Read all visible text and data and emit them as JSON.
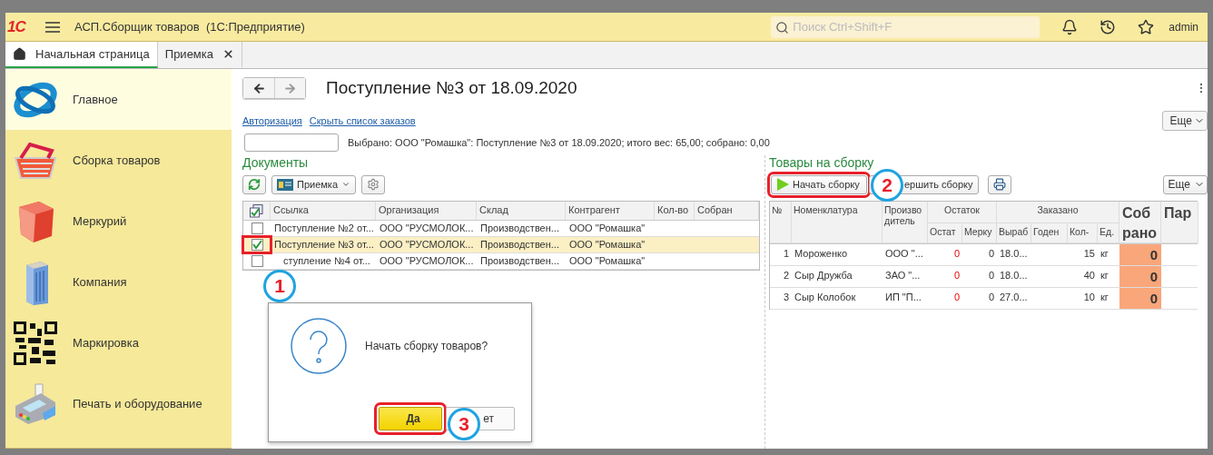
{
  "header": {
    "logo": "1С",
    "title": "АСП.Сборщик товаров  (1С:Предприятие)",
    "search": {
      "placeholder": "Поиск Ctrl+Shift+F"
    },
    "user": "admin"
  },
  "tabs": [
    {
      "label": "Начальная страница",
      "kind": "home",
      "selected": true
    },
    {
      "label": "Приемка",
      "kind": "closable",
      "selected": false
    }
  ],
  "sidebar": {
    "items": [
      {
        "label": "Главное",
        "kind": "orbit",
        "selected": true
      },
      {
        "label": "Сборка товаров",
        "kind": "basket",
        "selected": false
      },
      {
        "label": "Меркурий",
        "kind": "cube",
        "selected": false
      },
      {
        "label": "Компания",
        "kind": "building",
        "selected": false
      },
      {
        "label": "Маркировка",
        "kind": "qr",
        "selected": false
      },
      {
        "label": "Печать и оборудование",
        "kind": "terminal",
        "selected": false
      }
    ]
  },
  "form": {
    "title": "Поступление №3 от 18.09.2020",
    "links": [
      "Авторизация",
      "Скрыть список заказов"
    ],
    "more": "Еще",
    "summary": "Выбрано: ООО \"Ромашка\": Поступление №3 от 18.09.2020; итого вес: 65,00; собрано: 0,00"
  },
  "documents": {
    "title": "Документы",
    "toolbar_button": "Приемка",
    "columns": [
      "Ссылка",
      "Организация",
      "Склад",
      "Контрагент",
      "Кол-во",
      "Собран"
    ],
    "rows": [
      {
        "checked": false,
        "selected": false,
        "highlighted": false,
        "cells": [
          "Поступление №2 от...",
          "ООО \"РУСМОЛОК...",
          "Производствен...",
          "ООО \"Ромашка\"",
          "",
          ""
        ]
      },
      {
        "checked": true,
        "selected": true,
        "highlighted": true,
        "callout": "1",
        "cells": [
          "Поступление №3 от...",
          "ООО \"РУСМОЛОК...",
          "Производствен...",
          "ООО \"Ромашка\"",
          "",
          ""
        ]
      },
      {
        "checked": false,
        "selected": false,
        "highlighted": false,
        "cells": [
          "ступление №4 от...",
          "ООО \"РУСМОЛОК...",
          "Производствен...",
          "ООО \"Ромашка\"",
          "",
          ""
        ]
      }
    ]
  },
  "goods": {
    "title": "Товары на сборку",
    "more": "Еще",
    "buttons": [
      {
        "label": "Начать сборку",
        "kind": "start",
        "highlighted": true,
        "callout": "2"
      },
      {
        "label": "ершить сборку",
        "kind": "finish",
        "highlighted": false
      }
    ],
    "columns": [
      {
        "label": "№"
      },
      {
        "label": "Номенклатура"
      },
      {
        "label": "Производитель"
      },
      {
        "label": "Остат",
        "group": "Остаток"
      },
      {
        "label": "Мерку",
        "grouped": true
      },
      {
        "label": "Выраб",
        "group": "Заказано"
      },
      {
        "label": "Годен",
        "grouped": true
      },
      {
        "label": "Кол-",
        "grouped": true
      },
      {
        "label": "Ед.",
        "grouped": true
      },
      {
        "label": "Собрано"
      },
      {
        "label": "Пар"
      }
    ],
    "rows": [
      [
        "1",
        "Мороженко",
        "ООО \"...",
        "0",
        "0",
        "18.0...",
        "",
        "15",
        "кг",
        "0",
        ""
      ],
      [
        "2",
        "Сыр Дружба",
        "ЗАО \"...",
        "0",
        "0",
        "18.0...",
        "",
        "40",
        "кг",
        "0",
        ""
      ],
      [
        "3",
        "Сыр Колобок",
        "ИП \"П...",
        "0",
        "0",
        "27.0...",
        "",
        "10",
        "кг",
        "0",
        ""
      ]
    ]
  },
  "dialog": {
    "question": "Начать сборку товаров?",
    "buttons": [
      {
        "label": "Да",
        "kind": "yes",
        "highlighted": true,
        "callout": "3"
      },
      {
        "label": "ет",
        "kind": "no",
        "highlighted": false
      }
    ]
  }
}
